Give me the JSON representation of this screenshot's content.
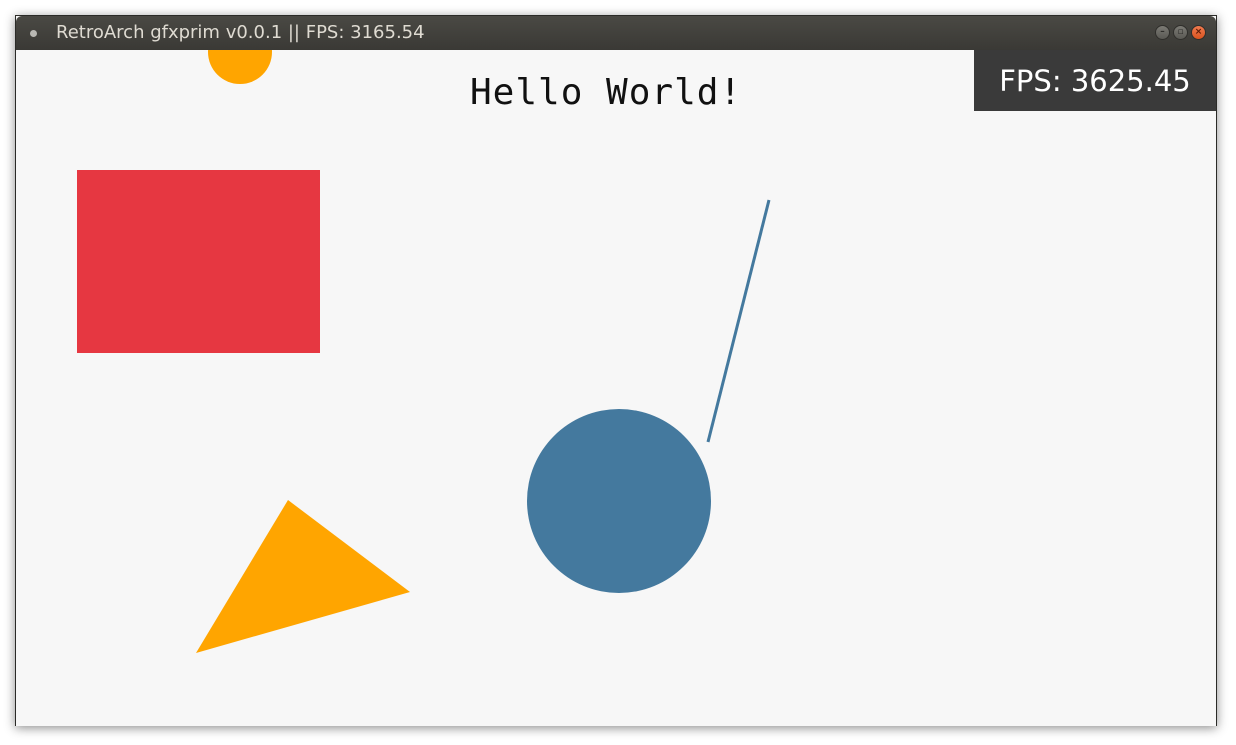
{
  "window": {
    "title": "RetroArch gfxprim v0.0.1 || FPS: 3165.54",
    "buttons": {
      "minimize_glyph": "–",
      "maximize_glyph": "▫",
      "close_glyph": "×"
    }
  },
  "canvas": {
    "heading": "Hello World!",
    "fps_overlay": "FPS: 3625.45",
    "background_color": "#f7f7f7"
  },
  "colors": {
    "orange": "#ffa500",
    "red": "#e63741",
    "blue": "#44799e",
    "overlay": "#3a3a3a"
  }
}
